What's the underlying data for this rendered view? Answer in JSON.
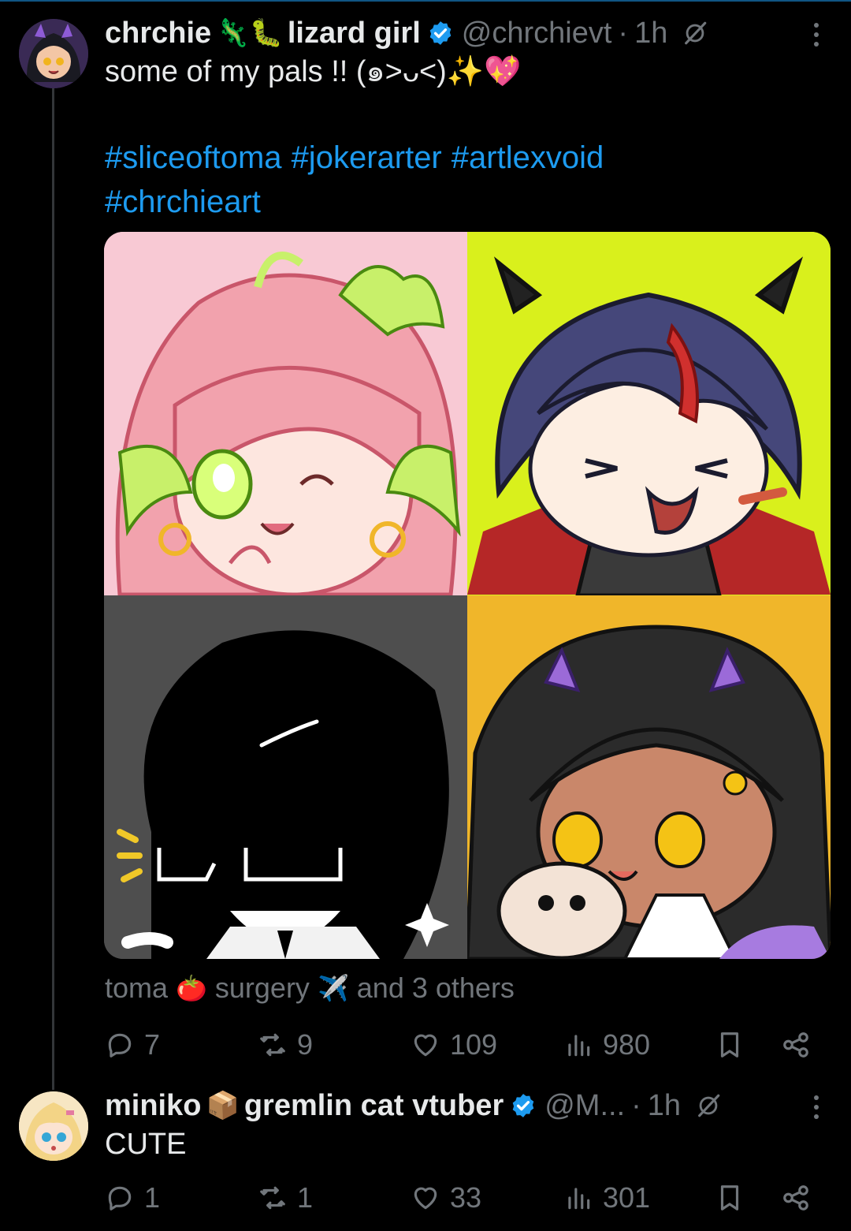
{
  "tweet": {
    "author_name": "chrchie",
    "author_emojis": "🦎🐛",
    "author_name_suffix": "lizard girl",
    "handle": "@chrchievt",
    "separator": "·",
    "time": "1h",
    "text": "some of my pals !! (๑>ᴗ<)✨💖",
    "hashtags": [
      "#sliceoftoma",
      "#jokerarter",
      "#artlexvoid",
      "#chrchieart"
    ],
    "liked_by": {
      "first": "toma",
      "first_emoji": "🍅",
      "second": "surgery",
      "second_emoji": "✈️",
      "rest": "and 3 others"
    },
    "stats": {
      "replies": "7",
      "reposts": "9",
      "likes": "109",
      "views": "980"
    }
  },
  "reply": {
    "author_name": "miniko",
    "author_emoji": "📦",
    "author_name_suffix": "gremlin cat vtuber",
    "handle": "@M...",
    "separator": "·",
    "time": "1h",
    "text": "CUTE",
    "stats": {
      "replies": "1",
      "reposts": "1",
      "likes": "33",
      "views": "301"
    }
  },
  "icons": {
    "verified": "verified-badge-icon",
    "grok": "grok-icon",
    "more": "more-options-icon",
    "reply": "reply-icon",
    "repost": "repost-icon",
    "like": "heart-icon",
    "views": "views-icon",
    "bookmark": "bookmark-icon",
    "share": "share-icon"
  },
  "colors": {
    "background": "#000000",
    "text": "#e7e9ea",
    "muted": "#71767b",
    "accent": "#1d9bf0",
    "tile_pink": "#f8c9d4",
    "tile_lime": "#d9f01c",
    "tile_gray": "#4e4e4e",
    "tile_yellow": "#f0b62a"
  }
}
